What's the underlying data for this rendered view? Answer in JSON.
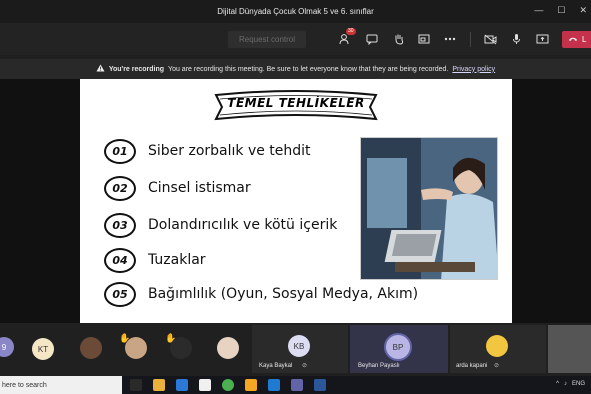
{
  "window": {
    "title": "Dijital Dünyada Çocuk Olmak 5 ve 6. sınıflar",
    "controls": [
      "—",
      "☐",
      "✕"
    ]
  },
  "toolbar": {
    "request_control_label": "Request control",
    "participants_badge": "30",
    "leave_label": "L"
  },
  "recording_banner": {
    "title": "You're recording",
    "message": "You are recording this meeting. Be sure to let everyone know that they are being recorded.",
    "link": "Privacy policy"
  },
  "slide": {
    "heading": "TEMEL TEHLİKELER",
    "items": [
      {
        "num": "01",
        "text": "Siber zorbalık ve tehdit"
      },
      {
        "num": "02",
        "text": "Cinsel istismar"
      },
      {
        "num": "03",
        "text": "Dolandırıcılık ve kötü içerik"
      },
      {
        "num": "04",
        "text": "Tuzaklar"
      },
      {
        "num": "05",
        "text": "Bağımlılık (Oyun, Sosyal Medya, Akım)"
      }
    ]
  },
  "participants": [
    {
      "initials": "9",
      "name": ""
    },
    {
      "initials": "KT",
      "name": ""
    },
    {
      "initials": "KB",
      "name": "Kaya Baykal"
    },
    {
      "initials": "BP",
      "name": "Beyhan Payaslı"
    },
    {
      "initials": "",
      "name": "arda kapani"
    }
  ],
  "taskbar": {
    "search_placeholder": "here to search",
    "language": "ENG"
  },
  "colors": {
    "accent": "#6264a7",
    "leave": "#c4314b",
    "bp_avatar": "#b9b6e6",
    "kt_avatar": "#f5e6c6"
  }
}
